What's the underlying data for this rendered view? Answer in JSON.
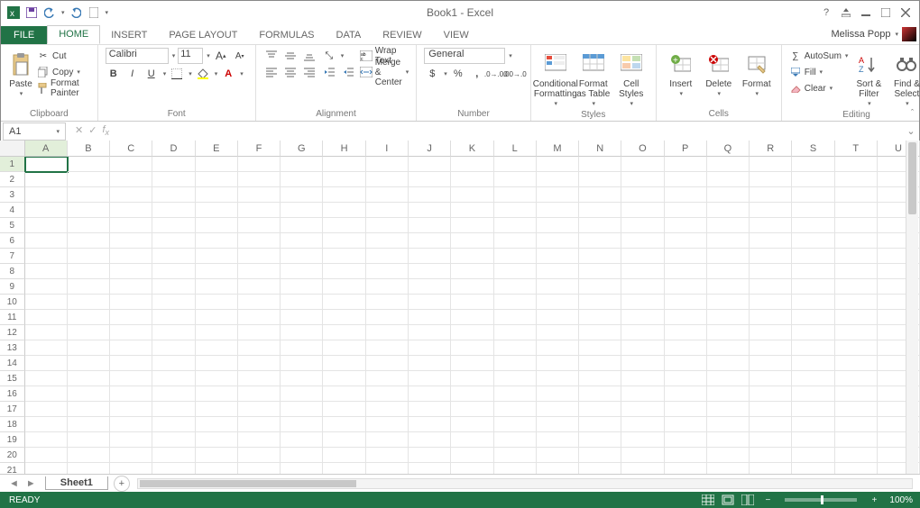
{
  "title": "Book1 - Excel",
  "user": {
    "name": "Melissa Popp"
  },
  "tabs": {
    "file": "FILE",
    "items": [
      "HOME",
      "INSERT",
      "PAGE LAYOUT",
      "FORMULAS",
      "DATA",
      "REVIEW",
      "VIEW"
    ],
    "active": 0
  },
  "ribbon": {
    "clipboard": {
      "paste": "Paste",
      "cut": "Cut",
      "copy": "Copy",
      "format_painter": "Format Painter",
      "label": "Clipboard"
    },
    "font": {
      "name": "Calibri",
      "size": "11",
      "label": "Font"
    },
    "alignment": {
      "wrap": "Wrap Text",
      "merge": "Merge & Center",
      "label": "Alignment"
    },
    "number": {
      "format": "General",
      "label": "Number"
    },
    "styles": {
      "cond": "Conditional Formatting",
      "table": "Format as Table",
      "cell": "Cell Styles",
      "label": "Styles"
    },
    "cells": {
      "insert": "Insert",
      "delete": "Delete",
      "format": "Format",
      "label": "Cells"
    },
    "editing": {
      "autosum": "AutoSum",
      "fill": "Fill",
      "clear": "Clear",
      "sort": "Sort & Filter",
      "find": "Find & Select",
      "label": "Editing"
    }
  },
  "formula_bar": {
    "name_box": "A1"
  },
  "grid": {
    "columns": [
      "A",
      "B",
      "C",
      "D",
      "E",
      "F",
      "G",
      "H",
      "I",
      "J",
      "K",
      "L",
      "M",
      "N",
      "O",
      "P",
      "Q",
      "R",
      "S",
      "T",
      "U"
    ],
    "rows": 22,
    "active": "A1"
  },
  "sheet_tabs": {
    "active": "Sheet1"
  },
  "status": {
    "ready": "READY",
    "zoom": "100%"
  }
}
